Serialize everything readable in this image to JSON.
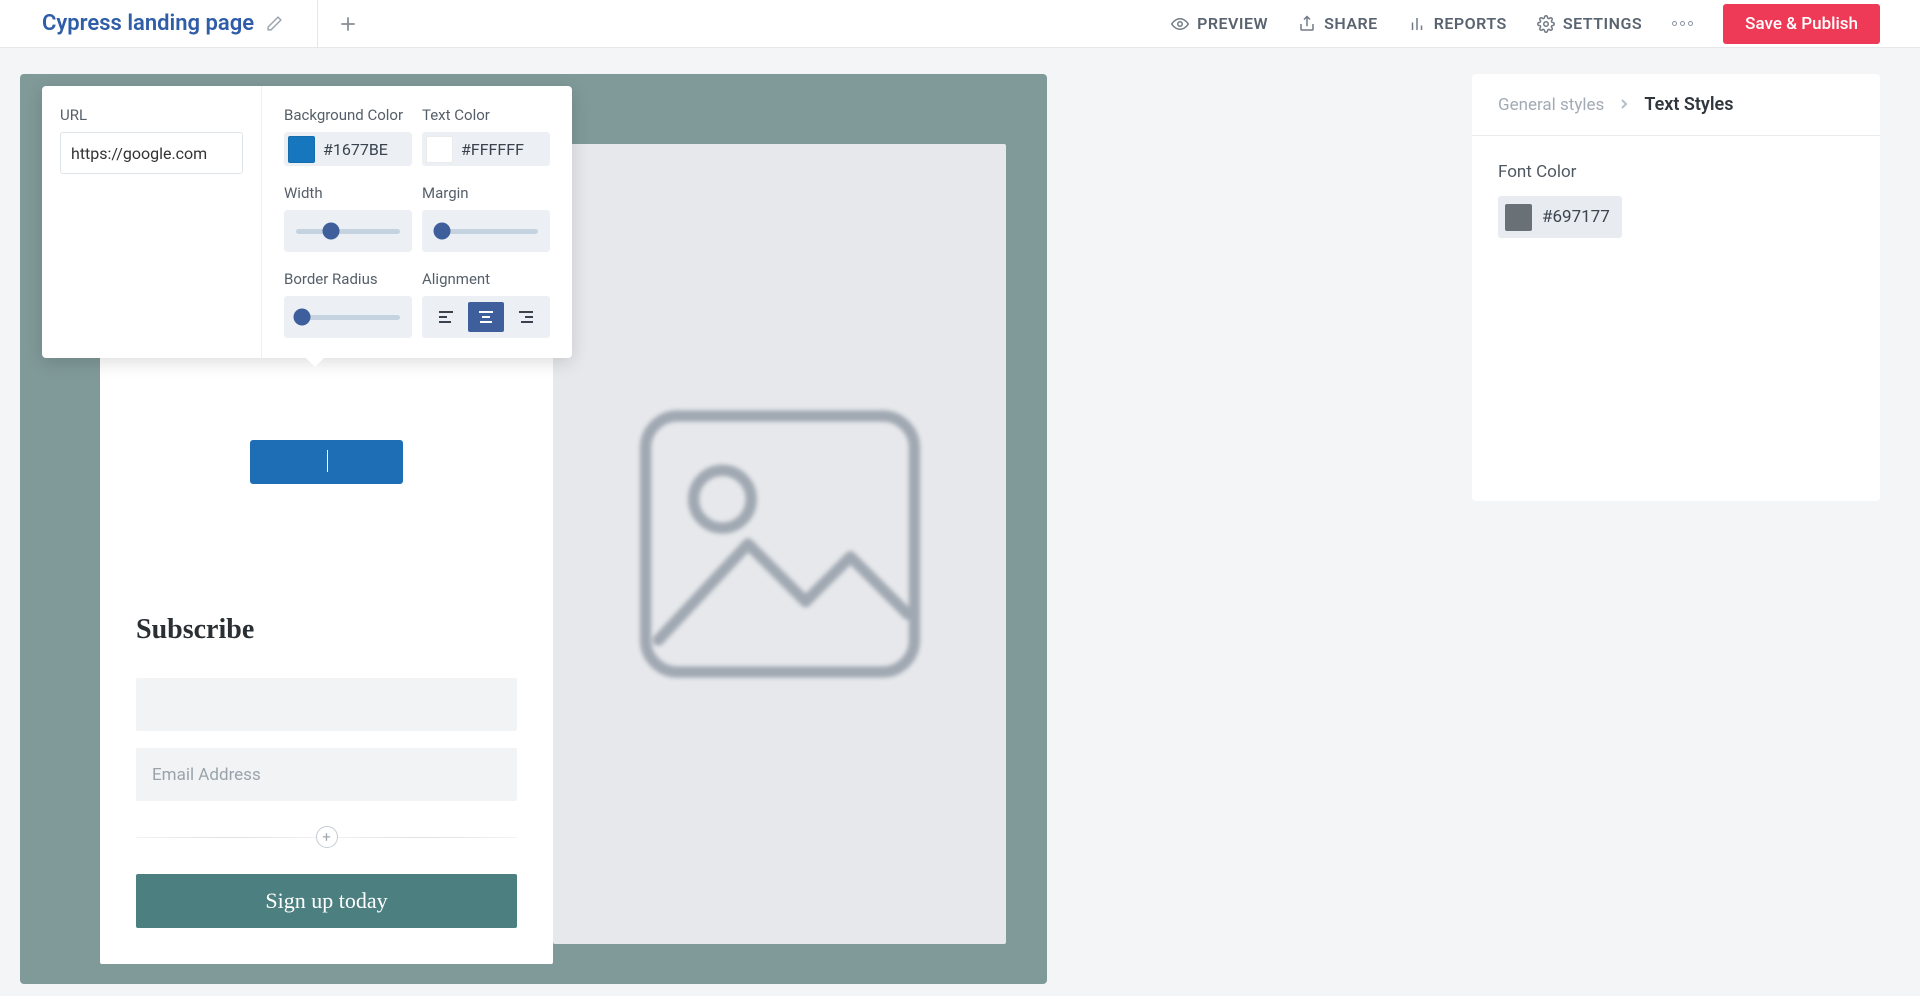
{
  "topbar": {
    "title": "Cypress landing page",
    "menu": {
      "preview": "PREVIEW",
      "share": "SHARE",
      "reports": "REPORTS",
      "settings": "SETTINGS"
    },
    "publish": "Save & Publish"
  },
  "props": {
    "url": {
      "label": "URL",
      "value": "https://google.com"
    },
    "bg": {
      "label": "Background Color",
      "value": "#1677BE",
      "swatch": "#1677BE"
    },
    "text": {
      "label": "Text Color",
      "value": "#FFFFFF",
      "swatch": "#ffffff"
    },
    "width": {
      "label": "Width",
      "pct": 34
    },
    "margin": {
      "label": "Margin",
      "pct": 8
    },
    "radius": {
      "label": "Border Radius",
      "pct": 6
    },
    "align": {
      "label": "Alignment",
      "value": "center"
    }
  },
  "canvas": {
    "subscribe": {
      "heading": "Subscribe",
      "name_placeholder": "",
      "email_placeholder": "Email Address",
      "submit": "Sign up today"
    }
  },
  "sidebar": {
    "breadcrumb_parent": "General styles",
    "breadcrumb_current": "Text Styles",
    "font_color": {
      "label": "Font Color",
      "value": "#697177"
    }
  }
}
